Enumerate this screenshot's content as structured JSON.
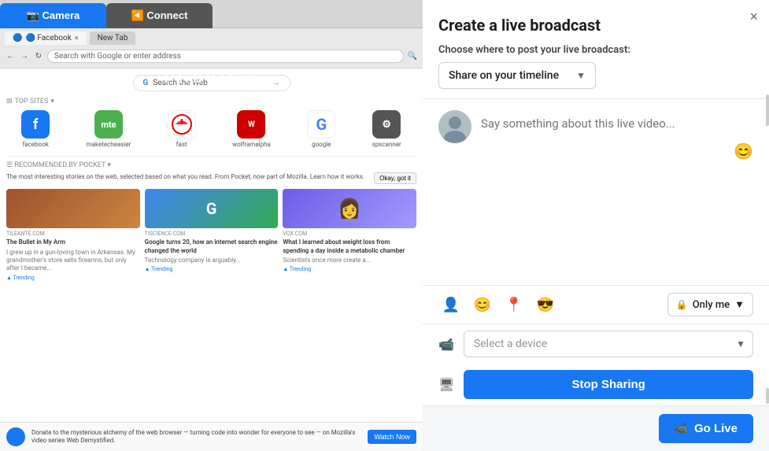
{
  "left_panel": {
    "tabs": [
      {
        "label": "📷 Camera",
        "active": true
      },
      {
        "label": "◀️ Connect",
        "active": false
      }
    ],
    "preview_label": "PREVIEW",
    "browser": {
      "tabs": [
        {
          "label": "🔵 Facebook",
          "active": true
        },
        {
          "label": "New Tab",
          "active": false
        }
      ],
      "address": "Search with Google or enter address",
      "search_bar": "Search the Web",
      "top_sites_label": "TOP SITES",
      "sites": [
        {
          "name": "facebook",
          "display": "F",
          "label": "facebook",
          "bg": "#1877f2",
          "color": "white"
        },
        {
          "name": "mte",
          "display": "m",
          "label": "maketecheasier",
          "bg": "#4CAF50",
          "color": "white"
        },
        {
          "name": "fast",
          "display": "⚡",
          "label": "fast",
          "bg": "white"
        },
        {
          "name": "wolfram",
          "display": "w",
          "label": "wolframalpha",
          "bg": "#c00",
          "color": "white"
        },
        {
          "name": "google",
          "display": "G",
          "label": "google",
          "bg": "white"
        },
        {
          "name": "spanner",
          "display": "≋",
          "label": "spscanner",
          "bg": "#555",
          "color": "white"
        }
      ],
      "recommended_label": "RECOMMENDED BY POCKET",
      "recommended_text": "The most interesting stories on the web, selected based on what you read. From Pocket, now part of Mozilla. Learn how it works.",
      "okay_btn": "Okay, got it",
      "articles": [
        {
          "source": "TILEANTE.COM",
          "title": "The Bullet in My Arm",
          "desc": "I grew up in a gun-loving town in Arkansas. My grandmother's store sells firearms, but only after I became...",
          "trending": "▲ Trending",
          "bg": "#8B4513"
        },
        {
          "source": "TISCIENCE.COM",
          "title": "Google turns 20, how an internet search engine changed the world",
          "desc": "Technology company is arguably...",
          "trending": "▲ Trending",
          "bg": "#4285f4"
        },
        {
          "source": "VOX.COM",
          "title": "What I learned about weight loss from spending a day inside a metabolic chamber",
          "desc": "Scientists once more create a...",
          "trending": "▲ Trending",
          "bg": "#6c5ce7"
        }
      ],
      "notification": {
        "text": "Donate to the mysterious alchemy of the web browser — turning code into wonder for everyone to see — on Mozilla's video series Web Demystified.",
        "btn": "Watch Now"
      }
    }
  },
  "right_panel": {
    "close_label": "×",
    "title": "Create a live broadcast",
    "post_target_label": "Choose where to post your live broadcast:",
    "timeline_dropdown": "Share on your timeline",
    "description_placeholder": "Say something about this live video...",
    "emoji_symbol": "😊",
    "action_icons": [
      {
        "name": "tag-people",
        "symbol": "👤"
      },
      {
        "name": "emoji",
        "symbol": "😊"
      },
      {
        "name": "location",
        "symbol": "📍"
      },
      {
        "name": "activity",
        "symbol": "😎"
      }
    ],
    "privacy": {
      "lock_symbol": "🔒",
      "label": "Only me",
      "arrow": "▼"
    },
    "device_section": {
      "camera_symbol": "📹",
      "select_placeholder": "Select a device",
      "chevron": "▼",
      "screen_symbol": "🖥"
    },
    "stop_sharing_btn": "Stop Sharing",
    "go_live_btn": "Go Live",
    "go_live_icon": "📹"
  }
}
